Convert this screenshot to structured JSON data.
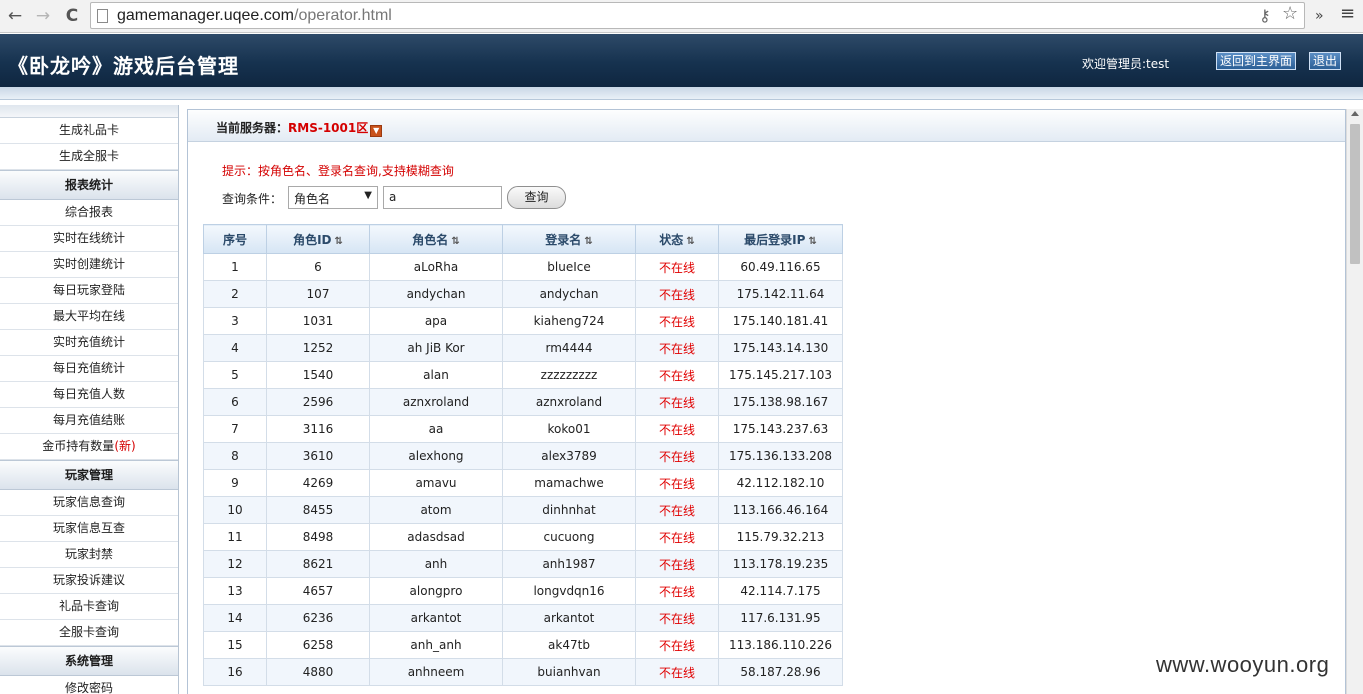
{
  "browser": {
    "back_icon": "←",
    "forward_icon": "→",
    "reload_icon": "C",
    "url_host": "gamemanager.uqee.com",
    "url_path": "/operator.html",
    "extension_icon": "»",
    "menu_icon": "≡",
    "key_icon": "⚷",
    "star_icon": "☆"
  },
  "header": {
    "title": "《卧龙吟》游戏后台管理",
    "welcome": "欢迎管理员:test",
    "home_button": "返回到主界面",
    "logout_button": "退出"
  },
  "sidebar": {
    "group_gift": [
      {
        "label": "生成礼品卡"
      },
      {
        "label": "生成全服卡"
      }
    ],
    "report_heading": "报表统计",
    "report_items": [
      {
        "label": "综合报表"
      },
      {
        "label": "实时在线统计"
      },
      {
        "label": "实时创建统计"
      },
      {
        "label": "每日玩家登陆"
      },
      {
        "label": "最大平均在线"
      },
      {
        "label": "实时充值统计"
      },
      {
        "label": "每日充值统计"
      },
      {
        "label": "每日充值人数"
      },
      {
        "label": "每月充值结账"
      }
    ],
    "gold_item": {
      "label": "金币持有数量",
      "tag": "(新)"
    },
    "player_heading": "玩家管理",
    "player_items": [
      {
        "label": "玩家信息查询"
      },
      {
        "label": "玩家信息互查"
      },
      {
        "label": "玩家封禁"
      },
      {
        "label": "玩家投诉建议"
      },
      {
        "label": "礼品卡查询"
      },
      {
        "label": "全服卡查询"
      }
    ],
    "system_heading": "系统管理",
    "system_items": [
      {
        "label": "修改密码"
      }
    ]
  },
  "server": {
    "label": "当前服务器：",
    "name": "RMS-1001区"
  },
  "search": {
    "hint": "提示：按角色名、登录名查询,支持模糊查询",
    "label": "查询条件：",
    "field_selected": "角色名",
    "keyword": "a",
    "button": "查询"
  },
  "table": {
    "headers": [
      "序号",
      "角色ID",
      "角色名",
      "登录名",
      "状态",
      "最后登录IP"
    ],
    "rows": [
      [
        "1",
        "6",
        "aLoRha",
        "blueIce",
        "不在线",
        "60.49.116.65"
      ],
      [
        "2",
        "107",
        "andychan",
        "andychan",
        "不在线",
        "175.142.11.64"
      ],
      [
        "3",
        "1031",
        "apa",
        "kiaheng724",
        "不在线",
        "175.140.181.41"
      ],
      [
        "4",
        "1252",
        "ah JiB Kor",
        "rm4444",
        "不在线",
        "175.143.14.130"
      ],
      [
        "5",
        "1540",
        "alan",
        "zzzzzzzzz",
        "不在线",
        "175.145.217.103"
      ],
      [
        "6",
        "2596",
        "aznxroland",
        "aznxroland",
        "不在线",
        "175.138.98.167"
      ],
      [
        "7",
        "3116",
        "aa",
        "koko01",
        "不在线",
        "175.143.237.63"
      ],
      [
        "8",
        "3610",
        "alexhong",
        "alex3789",
        "不在线",
        "175.136.133.208"
      ],
      [
        "9",
        "4269",
        "amavu",
        "mamachwe",
        "不在线",
        "42.112.182.10"
      ],
      [
        "10",
        "8455",
        "atom",
        "dinhnhat",
        "不在线",
        "113.166.46.164"
      ],
      [
        "11",
        "8498",
        "adasdsad",
        "cucuong",
        "不在线",
        "115.79.32.213"
      ],
      [
        "12",
        "8621",
        "anh",
        "anh1987",
        "不在线",
        "113.178.19.235"
      ],
      [
        "13",
        "4657",
        "alongpro",
        "longvdqn16",
        "不在线",
        "42.114.7.175"
      ],
      [
        "14",
        "6236",
        "arkantot",
        "arkantot",
        "不在线",
        "117.6.131.95"
      ],
      [
        "15",
        "6258",
        "anh_anh",
        "ak47tb",
        "不在线",
        "113.186.110.226"
      ],
      [
        "16",
        "4880",
        "anhneem",
        "buianhvan",
        "不在线",
        "58.187.28.96"
      ]
    ]
  },
  "watermark": "www.wooyun.org"
}
